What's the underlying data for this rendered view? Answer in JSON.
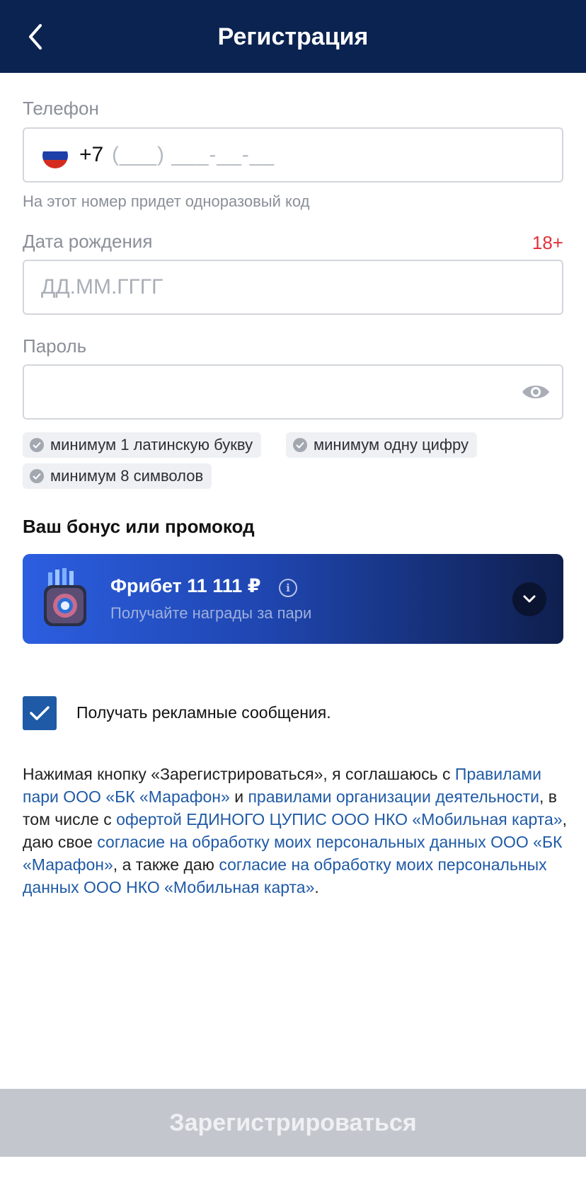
{
  "header": {
    "title": "Регистрация"
  },
  "phone": {
    "label": "Телефон",
    "country_code": "+7",
    "mask": "(___) ___-__-__",
    "hint": "На этот номер придет одноразовый код"
  },
  "birthdate": {
    "label": "Дата рождения",
    "age_limit": "18+",
    "placeholder": "ДД.ММ.ГГГГ"
  },
  "password": {
    "label": "Пароль",
    "requirements": [
      "минимум 1 латинскую букву",
      "минимум одну цифру",
      "минимум 8 символов"
    ]
  },
  "bonus": {
    "section_title": "Ваш бонус или промокод",
    "title": "Фрибет 11 111 ₽",
    "info_glyph": "i",
    "subtitle": "Получайте награды за пари"
  },
  "consent": {
    "label": "Получать рекламные сообщения.",
    "checked": true
  },
  "legal": {
    "t1": "Нажимая кнопку «Зарегистрироваться», я соглашаюсь с ",
    "l1": "Правилами пари ООО «БК «Марафон»",
    "t2": " и ",
    "l2": "правилами организации деятельности",
    "t3": ", в том числе с ",
    "l3": "офертой ЕДИНОГО ЦУПИС ООО НКО «Мобильная карта»",
    "t4": ", даю свое ",
    "l4": "согласие на обработку моих персональных данных ООО «БК «Марафон»",
    "t5": ", а также даю ",
    "l5": "согласие на обработку моих персональных данных ООО НКО «Мобильная карта»",
    "t6": "."
  },
  "submit": {
    "label": "Зарегистрироваться"
  },
  "colors": {
    "header_bg": "#0b2350",
    "link": "#1f5aa6",
    "age_badge": "#e0323a",
    "button_disabled": "#c3c7cd"
  }
}
